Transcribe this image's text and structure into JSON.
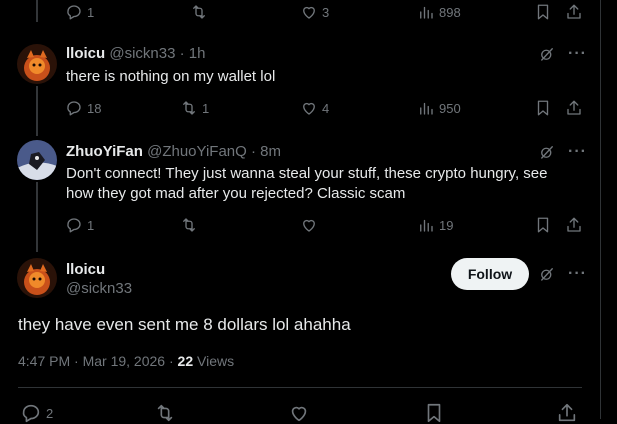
{
  "top_actions": {
    "replies": "1",
    "views": "898"
  },
  "reply1": {
    "name": "lloicu",
    "meta": "@sickn33 · 1h",
    "text": "there is nothing on my wallet lol",
    "replies": "18",
    "reposts": "1",
    "likes": "4",
    "views": "950"
  },
  "reply2": {
    "name": "ZhuoYiFan",
    "meta": "@ZhuoYiFanQ · 8m",
    "text": "Don't connect! They just wanna steal your stuff, these crypto hungry, see how they got mad after you rejected? Classic scam",
    "replies": "1",
    "views": "19"
  },
  "main_post": {
    "name": "lloicu",
    "handle": "@sickn33",
    "follow_label": "Follow",
    "text": "they have even sent me 8 dollars lol ahahha",
    "timestamp": "4:47 PM · Mar 19, 2026 · ",
    "views_count": "22",
    "views_label": " Views",
    "replies": "2"
  },
  "top_likes": "3"
}
